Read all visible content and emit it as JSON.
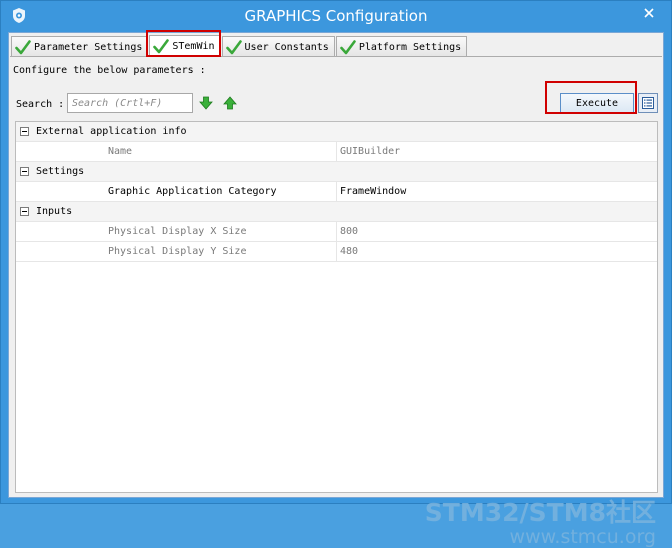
{
  "window": {
    "title": "GRAPHICS Configuration"
  },
  "tabs": [
    {
      "label": "Parameter Settings",
      "selected": false
    },
    {
      "label": "STemWin",
      "selected": true
    },
    {
      "label": "User Constants",
      "selected": false
    },
    {
      "label": "Platform Settings",
      "selected": false
    }
  ],
  "panel": {
    "configure_text": "Configure the below parameters :",
    "search_label": "Search :",
    "search_placeholder": "Search (Crtl+F)",
    "execute_label": "Execute"
  },
  "grid": {
    "sections": [
      {
        "label": "External application info",
        "rows": [
          {
            "name": "Name",
            "value": "GUIBuilder",
            "editable": false
          }
        ]
      },
      {
        "label": "Settings",
        "rows": [
          {
            "name": "Graphic Application Category",
            "value": "FrameWindow",
            "editable": true
          }
        ]
      },
      {
        "label": "Inputs",
        "rows": [
          {
            "name": "Physical Display X Size",
            "value": "800",
            "editable": false
          },
          {
            "name": "Physical Display Y Size",
            "value": "480",
            "editable": false
          }
        ]
      }
    ]
  },
  "watermark": {
    "brand": "STM32/STM8社区",
    "url": "www.stmcu.org"
  },
  "colors": {
    "titlebar": "#3c97dd",
    "highlight": "#d00000",
    "check": "#3aa83a"
  },
  "icons": {
    "app": "gear-shield-icon",
    "close": "close-icon",
    "tab_check": "green-check-icon",
    "down": "green-arrow-down-icon",
    "up": "green-arrow-up-icon",
    "list": "list-view-icon"
  }
}
